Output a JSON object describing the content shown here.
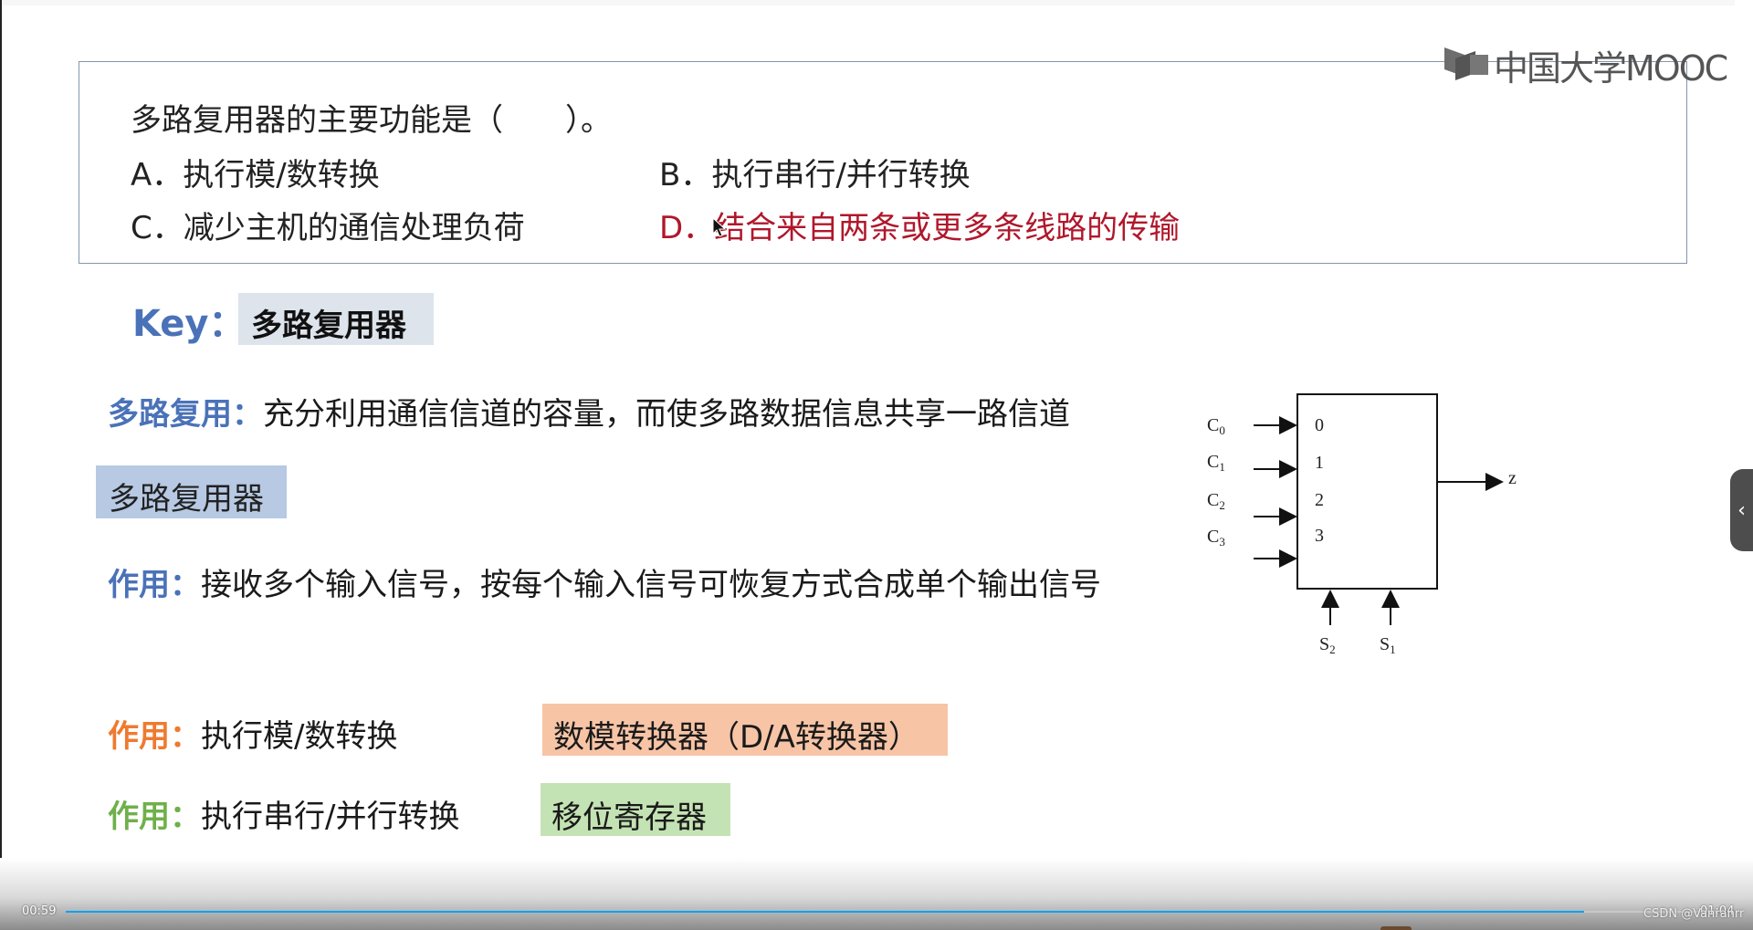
{
  "logo": {
    "text": "中国大学MOOC",
    "icon": "mooc-book-icon"
  },
  "question": {
    "stem": "多路复用器的主要功能是（　　）。",
    "options": [
      {
        "letter": "A．",
        "text": "执行模/数转换",
        "correct": false
      },
      {
        "letter": "B．",
        "text": "执行串行/并行转换",
        "correct": false
      },
      {
        "letter": "C．",
        "text": "减少主机的通信处理负荷",
        "correct": false
      },
      {
        "letter": "D．",
        "text": "结合来自两条或更多条线路的传输",
        "correct": true
      }
    ]
  },
  "key": {
    "label": "Key：",
    "term": "多路复用器"
  },
  "definitions": {
    "multiplexing": {
      "label": "多路复用：",
      "text": "充分利用通信信道的容量，而使多路数据信息共享一路信道"
    },
    "mux_box": "多路复用器",
    "mux_function": {
      "label": "作用：",
      "text": "接收多个输入信号，按每个输入信号可恢复方式合成单个输出信号"
    },
    "option_a": {
      "label": "作用：",
      "text": "执行模/数转换",
      "device": "数模转换器（D/A转换器）"
    },
    "option_b": {
      "label": "作用：",
      "text": "执行串行/并行转换",
      "device": "移位寄存器"
    }
  },
  "diagram": {
    "inputs": [
      "C0",
      "C1",
      "C2",
      "C3"
    ],
    "input_subscripts": [
      "0",
      "1",
      "2",
      "3"
    ],
    "ports": [
      "0",
      "1",
      "2",
      "3"
    ],
    "output": "z",
    "selects": [
      {
        "base": "S",
        "sub": "2"
      },
      {
        "base": "S",
        "sub": "1"
      }
    ]
  },
  "player": {
    "current_time": "00:59",
    "duration": "01:04",
    "progress_fraction": 0.92,
    "watermark": "CSDN @Vanranrr",
    "side_toggle": "‹"
  },
  "colors": {
    "correct_answer": "#b0172b",
    "accent_blue": "#4a72b8",
    "accent_orange": "#ee7a2f",
    "accent_green": "#6fb04a",
    "progress": "#0aa3f0"
  }
}
